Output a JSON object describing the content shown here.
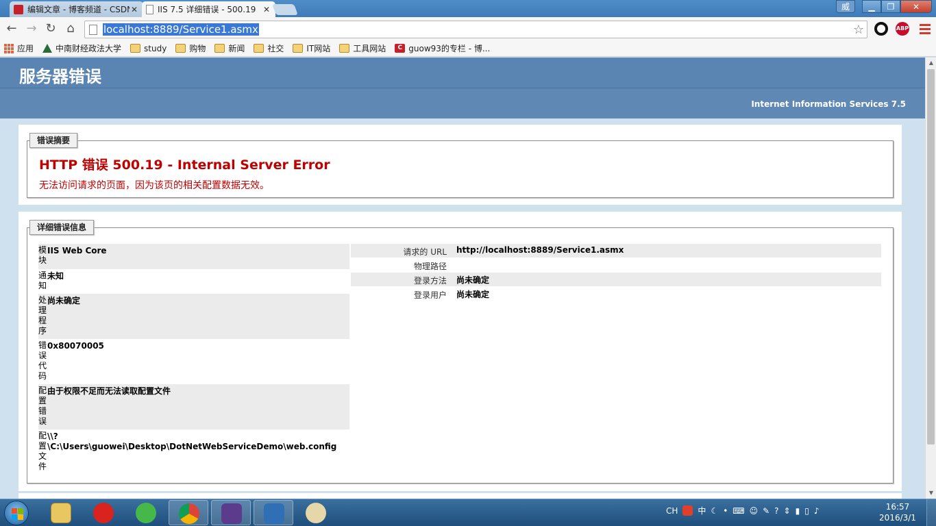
{
  "browser": {
    "tabs": [
      {
        "title": "编辑文章 - 博客频道 - CSDN",
        "active": false
      },
      {
        "title": "IIS 7.5 详细错误 - 500.19",
        "active": true
      }
    ],
    "window_user_glyph": "威",
    "url": "localhost:8889/Service1.asmx",
    "ext_abp_label": "ABP"
  },
  "bookmarks": [
    {
      "label": "应用",
      "icon": "apps-icon"
    },
    {
      "label": "中南财经政法大学",
      "icon": "university-icon"
    },
    {
      "label": "study",
      "icon": "folder-icon"
    },
    {
      "label": "购物",
      "icon": "folder-icon"
    },
    {
      "label": "新闻",
      "icon": "folder-icon"
    },
    {
      "label": "社交",
      "icon": "folder-icon"
    },
    {
      "label": "IT网站",
      "icon": "folder-icon"
    },
    {
      "label": "工具网站",
      "icon": "folder-icon"
    },
    {
      "label": "guow93的专栏 - 博...",
      "icon": "csdn-icon"
    }
  ],
  "page": {
    "header_title": "服务器错误",
    "header_sub": "Internet Information Services 7.5",
    "summary": {
      "legend": "错误摘要",
      "title": "HTTP 错误 500.19 - Internal Server Error",
      "description": "无法访问请求的页面，因为该页的相关配置数据无效。"
    },
    "detail": {
      "legend": "详细错误信息",
      "left_rows": [
        {
          "label": "模块",
          "value": "IIS Web Core",
          "value2": ""
        },
        {
          "label": "通知",
          "value": "未知",
          "value2": ""
        },
        {
          "label": "处理程序",
          "value": "尚未确定",
          "value2": ""
        },
        {
          "label": "错误代码",
          "value": "0x80070005",
          "value2": ""
        },
        {
          "label": "配置错误",
          "value": "由于权限不足而无法读取配置文件",
          "value2": ""
        },
        {
          "label": "配置文件",
          "value": "\\\\?",
          "value2": "\\C:\\Users\\guowei\\Desktop\\DotNetWebServiceDemo\\web.config"
        }
      ],
      "right_rows": [
        {
          "label": "请求的 URL",
          "value": "http://localhost:8889/Service1.asmx"
        },
        {
          "label": "物理路径",
          "value": ""
        },
        {
          "label": "登录方法",
          "value": "尚未确定"
        },
        {
          "label": "登录用户",
          "value": "尚未确定"
        }
      ]
    }
  },
  "taskbar": {
    "tray_items": [
      "CH",
      "中"
    ],
    "time": "16:57",
    "date": "2016/3/1"
  },
  "colors": {
    "error_red": "#c00000",
    "header_blue": "#5a84b2",
    "url_highlight": "#3a78d6"
  }
}
